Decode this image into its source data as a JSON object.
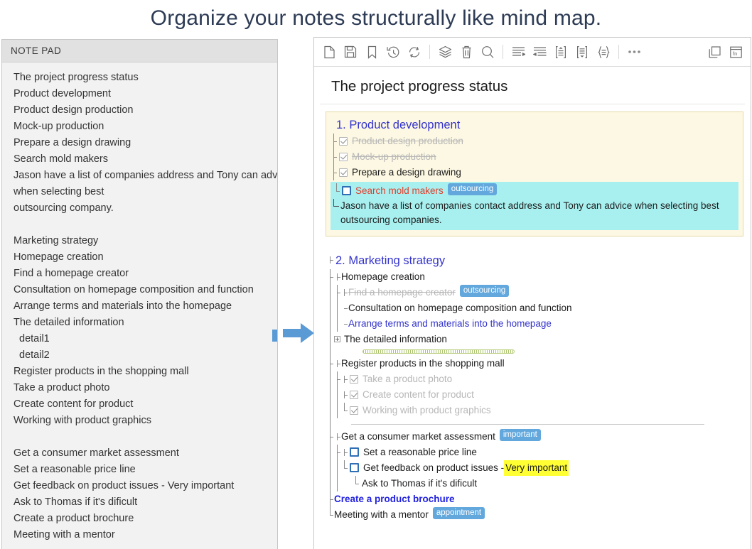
{
  "headline": "Organize your notes structurally like mind map.",
  "colors": {
    "accent_blue": "#5b9bd5",
    "tag_blue": "#62a8dd",
    "heading_blue": "#3333cc",
    "done_gray": "#b7b7b7",
    "red": "#e03c2a",
    "card_yellow_bg": "#fdf8e3",
    "card_yellow_border": "#e4d9a8",
    "card_cyan_bg": "#a8f0ef",
    "highlight_yellow": "#ffff33",
    "headline_navy": "#2d3b55"
  },
  "notepad": {
    "title": "NOTE PAD",
    "lines": [
      {
        "text": "The project progress status",
        "indent": false
      },
      {
        "text": "Product development",
        "indent": false
      },
      {
        "text": "Product design production",
        "indent": false
      },
      {
        "text": "Mock-up production",
        "indent": false
      },
      {
        "text": "Prepare a design drawing",
        "indent": false
      },
      {
        "text": "Search mold makers",
        "indent": false
      },
      {
        "text": "Jason have a list of companies address and Tony can advice",
        "indent": false
      },
      {
        "text": "when selecting best",
        "indent": false
      },
      {
        "text": "outsourcing company.",
        "indent": false
      },
      {
        "text": "",
        "indent": false
      },
      {
        "text": "Marketing strategy",
        "indent": false
      },
      {
        "text": "Homepage creation",
        "indent": false
      },
      {
        "text": "Find a homepage creator",
        "indent": false
      },
      {
        "text": "Consultation on homepage composition and function",
        "indent": false
      },
      {
        "text": "Arrange terms and materials into the homepage",
        "indent": false
      },
      {
        "text": "The detailed information",
        "indent": false
      },
      {
        "text": "detail1",
        "indent": true
      },
      {
        "text": "detail2",
        "indent": true
      },
      {
        "text": "Register products in the shopping mall",
        "indent": false
      },
      {
        "text": "Take a product photo",
        "indent": false
      },
      {
        "text": "Create content for product",
        "indent": false
      },
      {
        "text": "Working with product graphics",
        "indent": false
      },
      {
        "text": "",
        "indent": false
      },
      {
        "text": "Get a consumer market assessment",
        "indent": false
      },
      {
        "text": "Set a reasonable price line",
        "indent": false
      },
      {
        "text": "Get feedback on product issues - Very important",
        "indent": false
      },
      {
        "text": "Ask to Thomas if it's dificult",
        "indent": false
      },
      {
        "text": "Create a product brochure",
        "indent": false
      },
      {
        "text": "Meeting with a mentor",
        "indent": false
      }
    ]
  },
  "arrow": {
    "icon": "arrow-right-icon"
  },
  "editor": {
    "toolbar": [
      {
        "name": "new-document-icon",
        "label": "New"
      },
      {
        "name": "save-icon",
        "label": "Save"
      },
      {
        "name": "bookmark-icon",
        "label": "Bookmark"
      },
      {
        "name": "history-icon",
        "label": "History"
      },
      {
        "name": "sync-icon",
        "label": "Sync"
      },
      {
        "name": "separator",
        "label": ""
      },
      {
        "name": "layers-icon",
        "label": "Layers"
      },
      {
        "name": "trash-icon",
        "label": "Delete"
      },
      {
        "name": "search-icon",
        "label": "Search"
      },
      {
        "name": "separator",
        "label": ""
      },
      {
        "name": "outdent-icon",
        "label": "Outdent"
      },
      {
        "name": "indent-icon",
        "label": "Indent"
      },
      {
        "name": "move-up-icon",
        "label": "Move up"
      },
      {
        "name": "move-down-icon",
        "label": "Move down"
      },
      {
        "name": "group-icon",
        "label": "Group"
      },
      {
        "name": "separator",
        "label": ""
      },
      {
        "name": "more-options-icon",
        "label": "More"
      },
      {
        "name": "duplicate-icon",
        "label": "Duplicate"
      },
      {
        "name": "function-window-icon",
        "label": "fn"
      }
    ],
    "doc_title": "The project progress status",
    "sections": [
      {
        "number": "1.",
        "title": "Product development",
        "items": [
          {
            "text": "Product design production",
            "state": "checked",
            "style": "done"
          },
          {
            "text": "Mock-up production",
            "state": "checked",
            "style": "done"
          },
          {
            "text": "Prepare a design drawing",
            "state": "checked",
            "style": "normal"
          },
          {
            "text": "Search mold makers",
            "state": "unchecked",
            "style": "red",
            "tag": "outsourcing"
          }
        ],
        "note": "Jason have a list of companies contact address and Tony can advice when selecting best outsourcing companies."
      },
      {
        "number": "2.",
        "title": "Marketing strategy",
        "groups": [
          {
            "title": "Homepage creation",
            "items": [
              {
                "text": "Find a homepage creator",
                "style": "done",
                "tag": "outsourcing"
              },
              {
                "text": "Consultation on homepage composition and function",
                "style": "normal"
              },
              {
                "text": "Arrange terms and materials into the homepage",
                "style": "blue"
              }
            ],
            "collapsed_node": "The detailed information"
          },
          {
            "title": "Register products in the shopping mall",
            "items": [
              {
                "text": "Take a product photo",
                "state": "checked",
                "style": "done"
              },
              {
                "text": "Create content for product",
                "state": "checked",
                "style": "done"
              },
              {
                "text": "Working with product graphics",
                "state": "checked",
                "style": "done"
              }
            ]
          },
          {
            "title": "Get a consumer market assessment",
            "title_tag": "important",
            "items": [
              {
                "text": "Set a reasonable price line",
                "state": "unchecked",
                "style": "normal"
              },
              {
                "text": "Get feedback on product issues - ",
                "highlight": "Very important",
                "state": "unchecked",
                "style": "normal"
              },
              {
                "text": "Ask to Thomas if it's dificult",
                "style": "plain-child"
              }
            ]
          }
        ],
        "tail_items": [
          {
            "text": "Create a product brochure",
            "style": "bold-blue"
          },
          {
            "text": "Meeting with a mentor",
            "style": "normal",
            "tag": "appointment"
          }
        ]
      }
    ]
  }
}
